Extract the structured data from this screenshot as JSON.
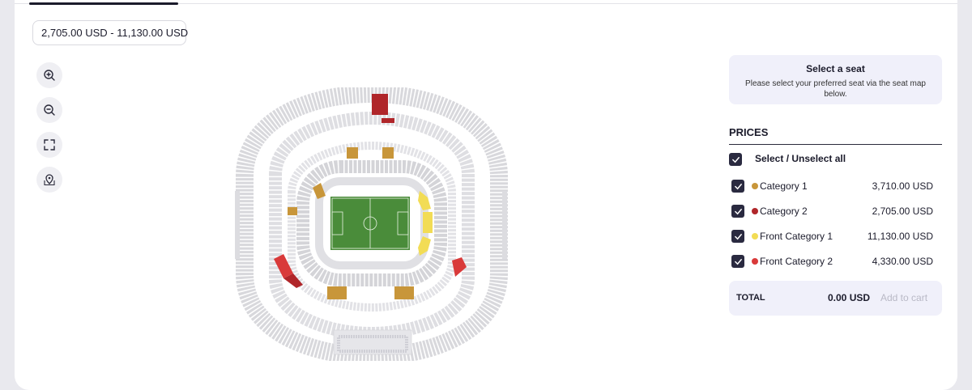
{
  "price_filter": {
    "value": "2,705.00 USD - 11,130.00 USD"
  },
  "map_controls": [
    "zoom-in-icon",
    "zoom-out-icon",
    "fullscreen-icon",
    "map-pin-icon"
  ],
  "info": {
    "title": "Select a seat",
    "text": "Please select your preferred seat via the seat map below."
  },
  "prices": {
    "title": "PRICES",
    "select_all_label": "Select / Unselect all",
    "categories": [
      {
        "label": "Category 1",
        "price": "3,710.00 USD",
        "color": "#c8963a",
        "checked": true
      },
      {
        "label": "Category 2",
        "price": "2,705.00 USD",
        "color": "#b0262a",
        "checked": true
      },
      {
        "label": "Front Category 1",
        "price": "11,130.00 USD",
        "color": "#f2dc55",
        "checked": true
      },
      {
        "label": "Front Category 2",
        "price": "4,330.00 USD",
        "color": "#d93a3a",
        "checked": true
      }
    ]
  },
  "total": {
    "label": "TOTAL",
    "value": "0.00 USD",
    "add_to_cart": "Add to cart"
  },
  "colors": {
    "pitch": "#4a8c3a",
    "seat_gray": "#d8d8dc",
    "checkbox": "#2a2a40",
    "panel_bg": "#f0f0fa"
  }
}
